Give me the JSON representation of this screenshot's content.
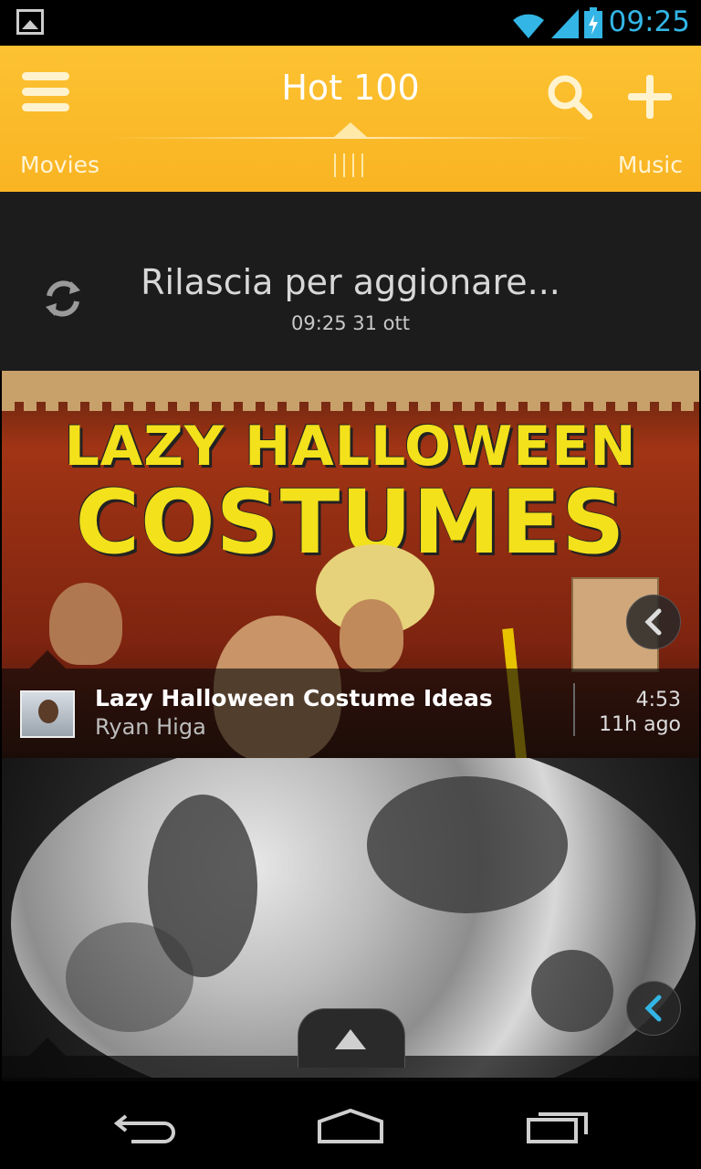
{
  "status_bar": {
    "time": "09:25",
    "icons": [
      "gallery-icon",
      "wifi-icon",
      "signal-icon",
      "battery-charging-icon"
    ],
    "clock_color": "#33b5e5"
  },
  "action_bar": {
    "title": "Hot 100",
    "left_tab": "Movies",
    "right_tab": "Music",
    "accent": "#f9b422"
  },
  "refresh": {
    "message": "Rilascia per aggionare...",
    "timestamp": "09:25 31 ott"
  },
  "videos": [
    {
      "thumbnail_text_line1": "LAZY HALLOWEEN",
      "thumbnail_text_line2": "COSTUMES",
      "title": "Lazy Halloween Costume Ideas",
      "channel": "Ryan Higa",
      "duration": "4:53",
      "age": "11h ago"
    }
  ],
  "nav_bar": {
    "buttons": [
      "back-icon",
      "home-icon",
      "recent-apps-icon"
    ]
  }
}
